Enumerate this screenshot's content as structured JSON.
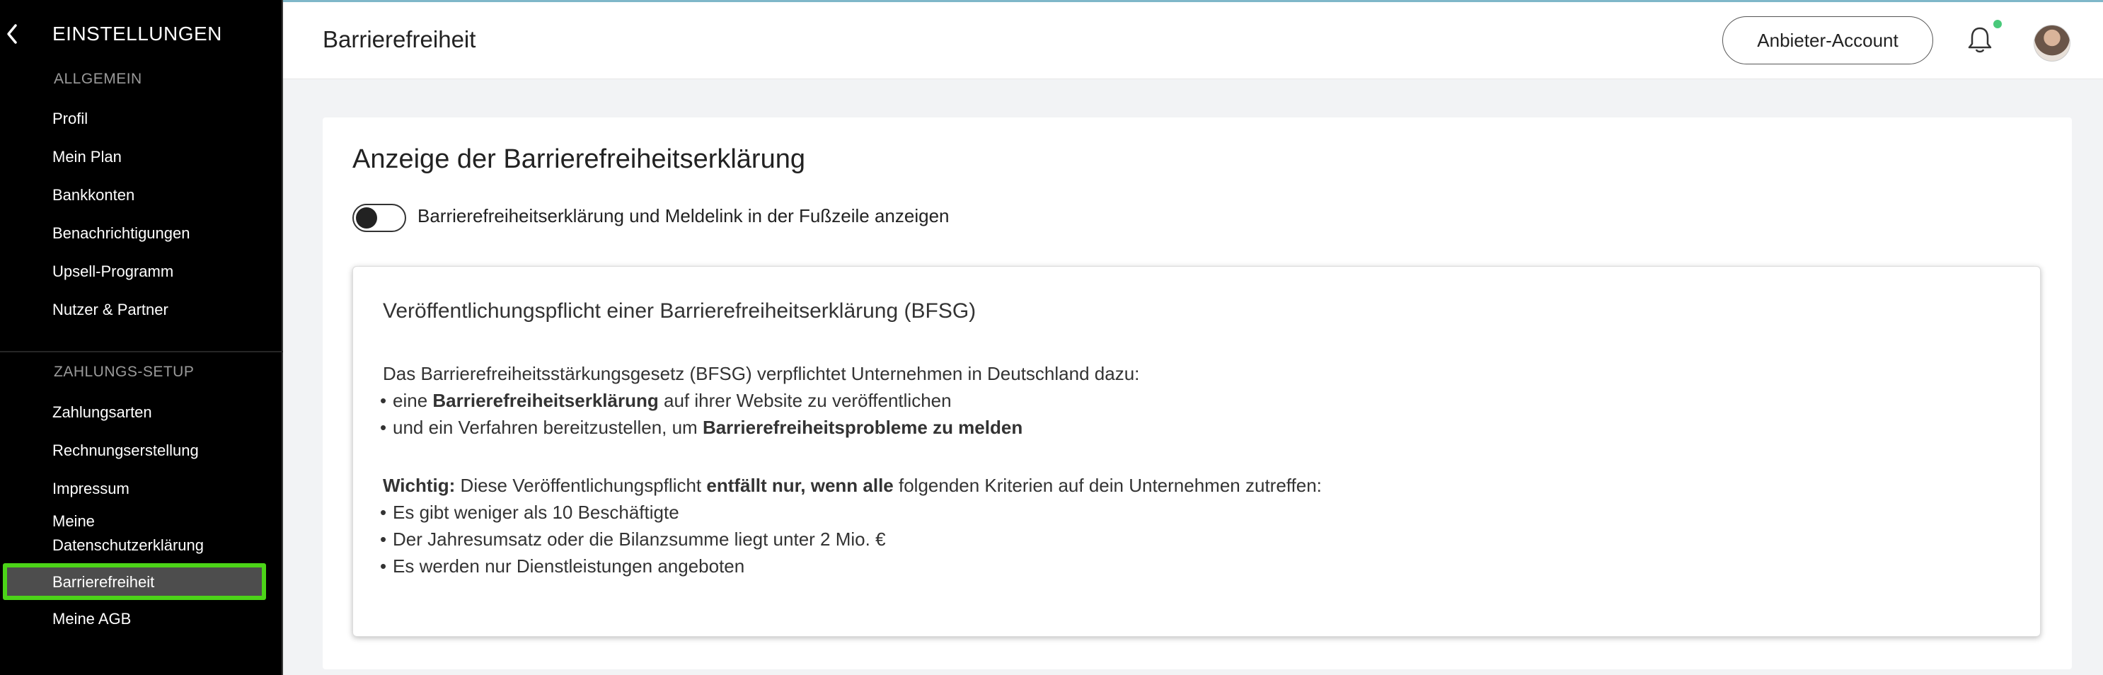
{
  "sidebar": {
    "title": "EINSTELLUNGEN",
    "section_general": "ALLGEMEIN",
    "general_items": [
      "Profil",
      "Mein Plan",
      "Bankkonten",
      "Benachrichtigungen",
      "Upsell-Programm",
      "Nutzer & Partner"
    ],
    "section_payment": "ZAHLUNGS-SETUP",
    "payment_items": [
      "Zahlungsarten",
      "Rechnungserstellung",
      "Impressum"
    ],
    "privacy_line1": "Meine",
    "privacy_line2": "Datenschutzerklärung",
    "active_item": "Barrierefreiheit",
    "last_item": "Meine AGB"
  },
  "topbar": {
    "title": "Barrierefreiheit",
    "account_button": "Anbieter-Account",
    "notification_dot_color": "#49c97a"
  },
  "main": {
    "heading": "Anzeige der Barrierefreiheitserklärung",
    "toggle_label": "Barrierefreiheitserklärung und Meldelink in der Fußzeile anzeigen",
    "toggle_state": "off",
    "info": {
      "title": "Veröffentlichungspflicht einer Barrierefreiheitserklärung (BFSG)",
      "intro": "Das Barrierefreiheitsstärkungsgesetz (BFSG) verpflichtet Unternehmen in Deutschland dazu:",
      "b1_pre": "eine ",
      "b1_bold": "Barrierefreiheitserklärung",
      "b1_post": " auf ihrer Website zu veröffentlichen",
      "b2_pre": "und ein Verfahren bereitzustellen, um ",
      "b2_bold": "Barrierefreiheitsprobleme zu melden",
      "imp_bold1": "Wichtig:",
      "imp_mid": " Diese Veröffentlichungspflicht ",
      "imp_bold2": "entfällt nur, wenn alle",
      "imp_post": " folgenden Kriterien auf dein Unternehmen zutreffen:",
      "criteria": [
        "Es gibt weniger als 10 Beschäftigte",
        "Der Jahresumsatz oder die Bilanzsumme liegt unter 2 Mio. €",
        "Es werden nur Dienstleistungen angeboten"
      ]
    }
  }
}
